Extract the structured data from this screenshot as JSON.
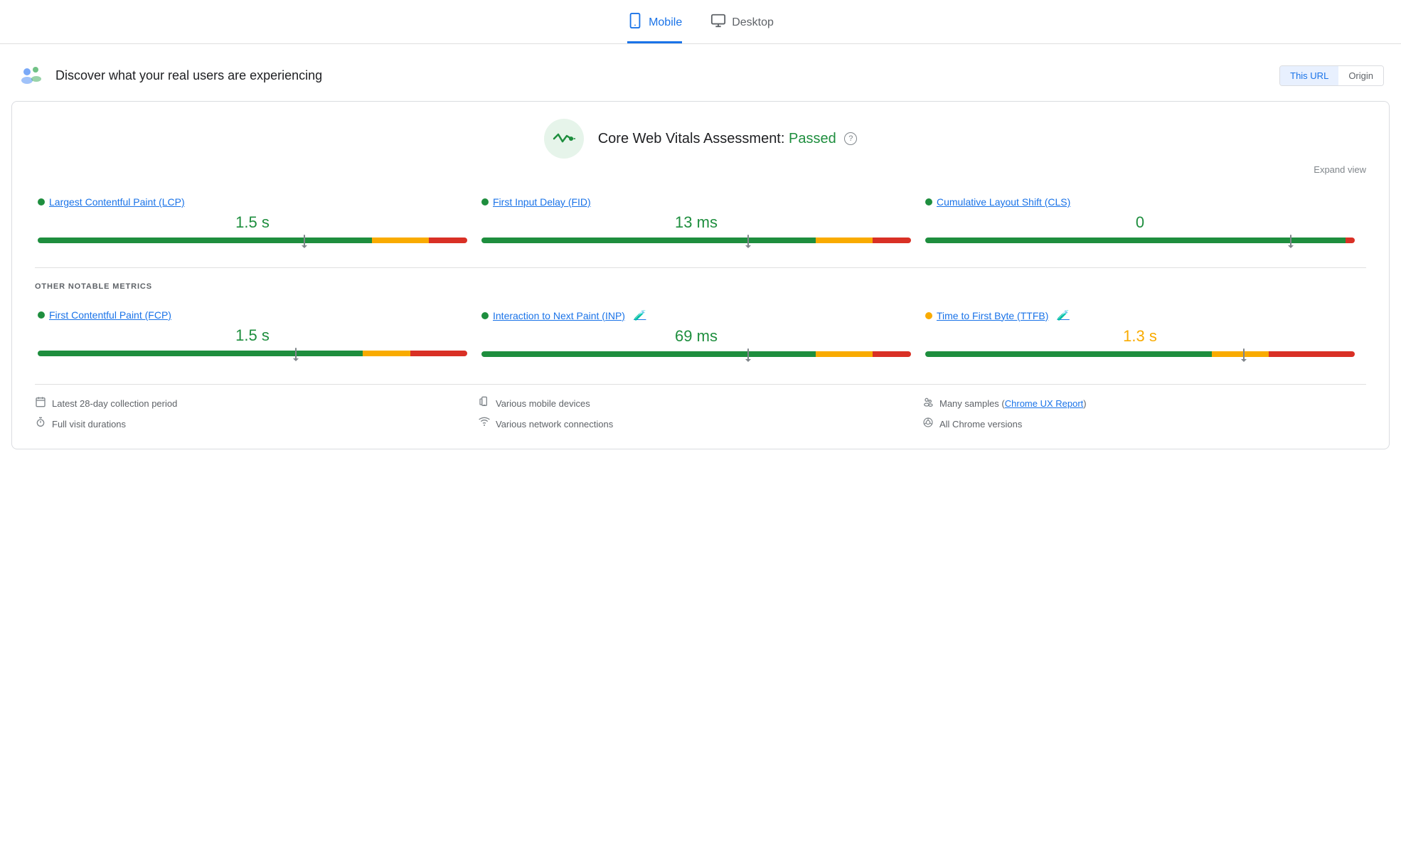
{
  "tabs": [
    {
      "id": "mobile",
      "label": "Mobile",
      "icon": "📱",
      "active": true
    },
    {
      "id": "desktop",
      "label": "Desktop",
      "icon": "🖥",
      "active": false
    }
  ],
  "header": {
    "title": "Discover what your real users are experiencing",
    "url_btn": "This URL",
    "origin_btn": "Origin"
  },
  "cwv": {
    "title": "Core Web Vitals Assessment:",
    "status": "Passed",
    "expand_label": "Expand view"
  },
  "metrics": [
    {
      "id": "lcp",
      "name": "Largest Contentful Paint (LCP)",
      "value": "1.5 s",
      "dot_color": "green",
      "bar": {
        "green": 70,
        "orange": 12,
        "red": 8,
        "marker_pct": 62
      },
      "value_color": "green"
    },
    {
      "id": "fid",
      "name": "First Input Delay (FID)",
      "value": "13 ms",
      "dot_color": "green",
      "bar": {
        "green": 70,
        "orange": 12,
        "red": 8,
        "marker_pct": 62
      },
      "value_color": "green"
    },
    {
      "id": "cls",
      "name": "Cumulative Layout Shift (CLS)",
      "value": "0",
      "dot_color": "green",
      "bar": {
        "green": 88,
        "orange": 0,
        "red": 2,
        "marker_pct": 85
      },
      "value_color": "green"
    }
  ],
  "other_metrics_label": "OTHER NOTABLE METRICS",
  "other_metrics": [
    {
      "id": "fcp",
      "name": "First Contentful Paint (FCP)",
      "value": "1.5 s",
      "dot_color": "green",
      "bar": {
        "green": 68,
        "orange": 10,
        "red": 12,
        "marker_pct": 60
      },
      "value_color": "green",
      "has_lab": false
    },
    {
      "id": "inp",
      "name": "Interaction to Next Paint (INP)",
      "value": "69 ms",
      "dot_color": "green",
      "bar": {
        "green": 70,
        "orange": 12,
        "red": 8,
        "marker_pct": 62
      },
      "value_color": "green",
      "has_lab": true
    },
    {
      "id": "ttfb",
      "name": "Time to First Byte (TTFB)",
      "value": "1.3 s",
      "dot_color": "orange",
      "bar": {
        "green": 60,
        "orange": 12,
        "red": 18,
        "marker_pct": 74
      },
      "value_color": "orange",
      "has_lab": true
    }
  ],
  "footer": {
    "col1": [
      {
        "icon": "📅",
        "text": "Latest 28-day collection period"
      },
      {
        "icon": "⏱",
        "text": "Full visit durations"
      }
    ],
    "col2": [
      {
        "icon": "📱",
        "text": "Various mobile devices"
      },
      {
        "icon": "📶",
        "text": "Various network connections"
      }
    ],
    "col3": [
      {
        "icon": "👥",
        "text": "Many samples (",
        "link": "Chrome UX Report",
        "text_after": ")"
      },
      {
        "icon": "🔵",
        "text": "All Chrome versions"
      }
    ]
  }
}
